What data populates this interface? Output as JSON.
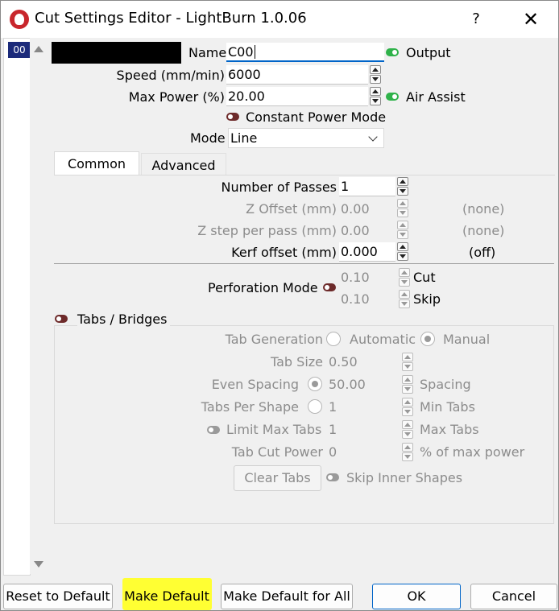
{
  "window": {
    "title": "Cut Settings Editor - LightBurn 1.0.06",
    "help_glyph": "?",
    "close_glyph": "✕"
  },
  "sidebar": {
    "items": [
      {
        "label": "00"
      }
    ]
  },
  "fields": {
    "name": {
      "label": "Name",
      "value": "C00"
    },
    "output": {
      "label": "Output"
    },
    "speed": {
      "label": "Speed (mm/min)",
      "value": "6000"
    },
    "max_power": {
      "label": "Max Power (%)",
      "value": "20.00"
    },
    "air_assist": {
      "label": "Air Assist"
    },
    "constant_power": {
      "label": "Constant Power Mode"
    },
    "mode": {
      "label": "Mode",
      "value": "Line"
    }
  },
  "tabs": [
    {
      "label": "Common"
    },
    {
      "label": "Advanced"
    }
  ],
  "common": {
    "passes": {
      "label": "Number of Passes",
      "value": "1"
    },
    "z_offset": {
      "label": "Z Offset (mm)",
      "value": "0.00",
      "note": "(none)"
    },
    "z_step": {
      "label": "Z step per pass (mm)",
      "value": "0.00",
      "note": "(none)"
    },
    "kerf": {
      "label": "Kerf offset (mm)",
      "value": "0.000",
      "note": "(off)"
    }
  },
  "perforation": {
    "label": "Perforation Mode",
    "cut_value": "0.10",
    "cut_label": "Cut",
    "skip_value": "0.10",
    "skip_label": "Skip"
  },
  "tabs_bridges": {
    "label": "Tabs / Bridges",
    "generation_label": "Tab Generation",
    "automatic": "Automatic",
    "manual": "Manual",
    "tab_size_label": "Tab Size",
    "tab_size": "0.50",
    "even_spacing_label": "Even Spacing",
    "even_spacing": "50.00",
    "spacing_label": "Spacing",
    "tabs_per_shape_label": "Tabs Per Shape",
    "tabs_per_shape": "1",
    "min_tabs_label": "Min Tabs",
    "limit_max_label": "Limit Max Tabs",
    "limit_max": "1",
    "max_tabs_label": "Max Tabs",
    "tab_cut_power_label": "Tab Cut Power",
    "tab_cut_power": "0",
    "power_suffix": "% of max power",
    "clear_tabs": "Clear Tabs",
    "skip_inner": "Skip Inner Shapes"
  },
  "buttons": {
    "reset": "Reset to Default",
    "make_default": "Make Default",
    "make_default_all": "Make Default for All",
    "ok": "OK",
    "cancel": "Cancel"
  },
  "colors": {
    "toggle_on": "#2fb24a",
    "toggle_off": "#6d2a2a",
    "highlight": "#ffff33",
    "selected_item": "#1b2a7a"
  }
}
